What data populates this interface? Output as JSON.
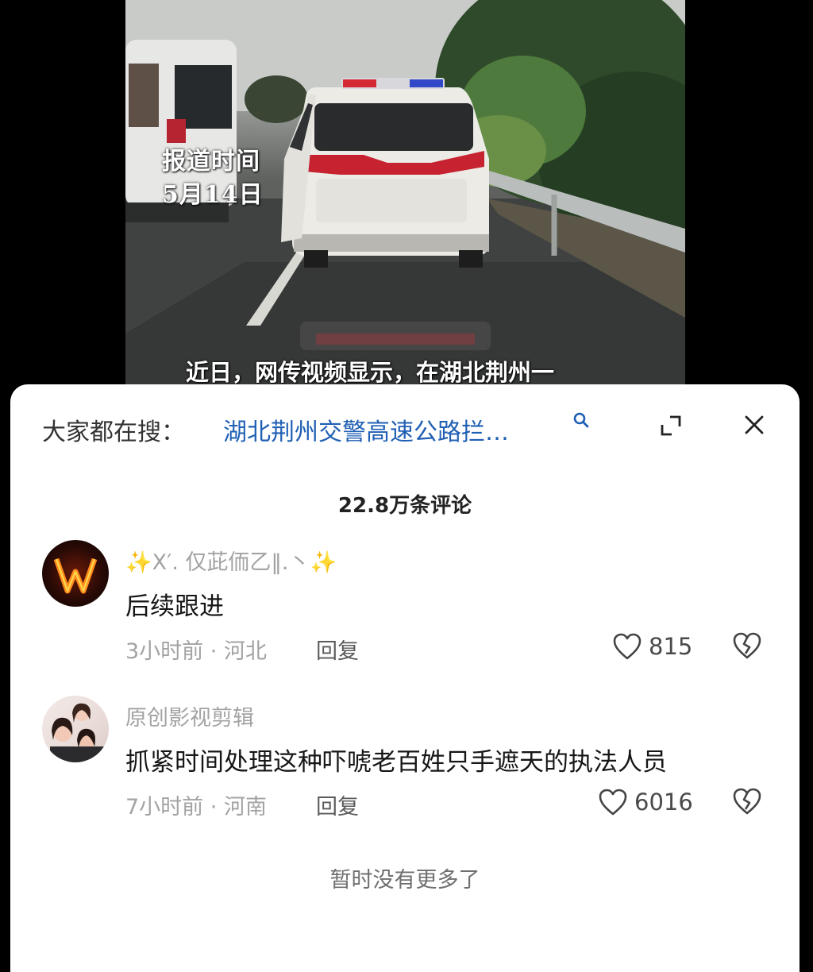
{
  "video": {
    "report_time_label": "报道时间",
    "report_date": "5月14日",
    "caption": "近日，网传视频显示，在湖北荆州一"
  },
  "search_bar": {
    "label": "大家都在搜：",
    "query": "湖北荆州交警高速公路拦…",
    "accent_color": "#1f5fb4"
  },
  "comment_count": "22.8万条评论",
  "comments": [
    {
      "username": "✨X′. 仅茈侕乙‖.丶✨",
      "text": "后续跟进",
      "time": "3小时前",
      "location": "河北",
      "reply_label": "回复",
      "likes": "815"
    },
    {
      "username": "原创影视剪辑",
      "text": "抓紧时间处理这种吓唬老百姓只手遮天的执法人员",
      "time": "7小时前",
      "location": "河南",
      "reply_label": "回复",
      "likes": "6016"
    }
  ],
  "no_more_text": "暂时没有更多了",
  "icons": {
    "search": "search-icon",
    "expand": "expand-icon",
    "close": "close-icon",
    "like": "heart-icon",
    "dislike": "broken-heart-icon"
  }
}
